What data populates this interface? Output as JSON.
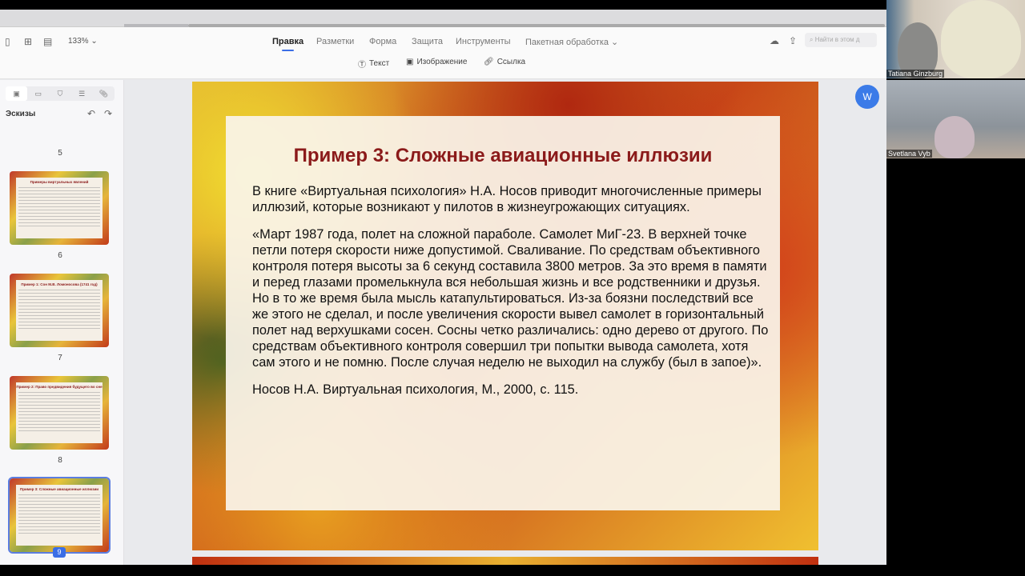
{
  "toolbar": {
    "zoom": "133% ⌄",
    "menus": [
      "Правка",
      "Разметки",
      "Форма",
      "Защита",
      "Инструменты",
      "Пакетная обработка ⌄"
    ],
    "sub": [
      "Текст",
      "Изображение",
      "Ссылка"
    ],
    "search_placeholder": "Найти в этом д"
  },
  "sidebar": {
    "title": "Эскизы",
    "pages": [
      "5",
      "6",
      "7",
      "8",
      "9"
    ],
    "thumbs": [
      "Примеры виртуальных явлений",
      "Пример 1: Сон М.В. Ломоносова (1741 год)",
      "Пример 2: Право предвидения будущего во сне",
      "Пример 3: Сложные авиационные иллюзии"
    ]
  },
  "slide": {
    "title": "Пример 3: Сложные авиационные иллюзии",
    "paragraphs": [
      "В книге «Виртуальная психология» Н.А. Носов приводит многочисленные примеры иллюзий, которые возникают у пилотов в жизнеугрожающих ситуациях.",
      "«Март 1987 года, полет на сложной параболе. Самолет МиГ-23. В верхней точке петли потеря скорости ниже допустимой. Сваливание. По средствам объективного контроля потеря высоты за 6 секунд составила 3800 метров. За это время в памяти и перед глазами промелькнула вся небольшая жизнь и все родственники и друзья. Но в то же время была мысль катапультироваться. Из-за боязни последствий все же этого не сделал, и после увеличения скорости вывел самолет в горизонтальный полет над верхушками сосен. Сосны четко различались: одно дерево от другого. По средствам объективного контроля совершил три попытки вывода самолета, хотя сам этого и не помню. После случая неделю не выходил на службу (был в запое)».",
      "Носов Н.А. Виртуальная психология, М., 2000, с. 115."
    ]
  },
  "video": {
    "participants": [
      "Tatiana Ginzburg",
      "Svetlana Vyb"
    ]
  }
}
